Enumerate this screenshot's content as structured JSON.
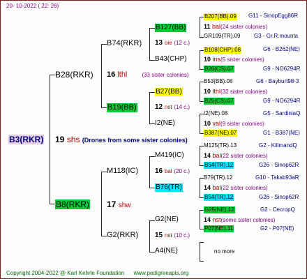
{
  "header": {
    "date": "20- 10-2022 ( 22: 26)"
  },
  "root": {
    "name": "B3(RKR)"
  },
  "gen1": {
    "num": "19",
    "breed": "shs",
    "note": "(Drones from some sister colonies)",
    "mother": "B28(RKR)",
    "father": "B8(RKR)"
  },
  "b28": {
    "num": "16",
    "breed": "lthl",
    "note": "(33 sister colonies)",
    "mother": "B74(RKR)",
    "father": "B19(BB)"
  },
  "b74": {
    "num": "13",
    "breed": "oie",
    "note": "(12 c.)",
    "mother": "B127(BB)",
    "father": "B43(CHP)"
  },
  "b127": {
    "num": "11",
    "breed": "bal",
    "note": "(24 sister colonies)",
    "mother": "B207(BB).09",
    "mother_info": "G11 - SinopEgg86R",
    "father": "GR109(TR).09",
    "father_info": "G3 - Gr.R.mounta"
  },
  "b43": {
    "num": "10",
    "breed": "ins",
    "note": "(5 sister colonies)",
    "mother": "B108(CHP).08",
    "mother_info": "G6 - B262(NE)",
    "father": "B26(CS).07",
    "father_info": "G9 - NO6294R"
  },
  "b19": {
    "num": "12",
    "breed": "nst",
    "note": "(14 c.)",
    "mother": "B27(BB)",
    "father": "I2(NE)"
  },
  "b27": {
    "num": "10",
    "breed": "lthl",
    "note": "(32 sister colonies)",
    "mother": "B53(BB).08",
    "mother_info": "G6 - Bayburt98-3",
    "father": "B25(CS).07",
    "father_info": "G9 - NO6294R"
  },
  "i2": {
    "num": "10",
    "breed": "val",
    "note": "(9 sister colonies)",
    "mother": "I2(NE).08",
    "mother_info": "G5 - SardiniaQ",
    "father": "B387(NE).07",
    "father_info": "G1 - B387(NE)"
  },
  "b8": {
    "num": "17",
    "breed": "shw",
    "mother": "M118(IC)",
    "father": "G2(RKR)"
  },
  "m118": {
    "num": "16",
    "breed": "bal",
    "note": "(20 c.)",
    "mother": "M419(IC)",
    "father": "B76(TR)"
  },
  "m419": {
    "num": "14",
    "breed": "bal",
    "note": "(22 sister colonies)",
    "mother": "M125(TR).13",
    "mother_info": "G2 - KilimandQ",
    "father": "B54(TR).12",
    "father_info": "G26 - Sinop62R"
  },
  "b76": {
    "num": "14",
    "breed": "bal",
    "note": "(22 sister colonies)",
    "mother": "B79(TR).12",
    "mother_info": "G10 - Takab93aR",
    "father": "B54(TR).12",
    "father_info": "G26 - Sinop62R"
  },
  "g2rkr": {
    "num": "15",
    "breed": "nst",
    "note": "(10 c.)",
    "mother": "G2(NE)",
    "father": "A4(NE)"
  },
  "g2ne": {
    "num": "14",
    "breed": "nst",
    "note": "(some sister colonies)",
    "mother": "G25(NE).12",
    "mother_info": "G2 - CecropQ",
    "father": "P07(NE).11",
    "father_info": "G2 - P07(NE)"
  },
  "a4": {
    "more": "no more"
  },
  "footer": {
    "copyright": "Copyright 2004-2022 @ Karl Kehrle Foundation",
    "site": "www.pedigreeapis.org"
  }
}
